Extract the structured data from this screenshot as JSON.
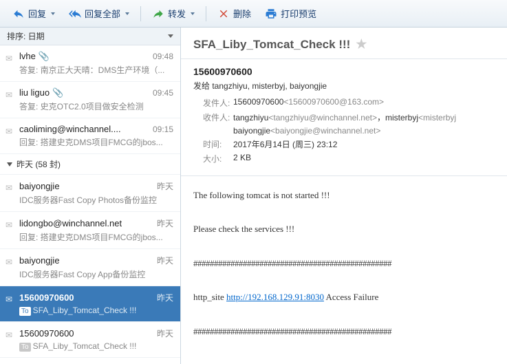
{
  "toolbar": {
    "reply": "回复",
    "reply_all": "回复全部",
    "forward": "转发",
    "delete": "删除",
    "print": "打印预览"
  },
  "sort": {
    "label": "排序: 日期"
  },
  "group": {
    "yesterday": "昨天 (58 封)"
  },
  "messages": [
    {
      "from": "lvhe",
      "time": "09:48",
      "subject": "答复: 南京正大天晴：DMS生产环境（...",
      "attach": true
    },
    {
      "from": "liu liguo",
      "time": "09:45",
      "subject": "答复: 史克OTC2.0项目做安全检测",
      "attach": true
    },
    {
      "from": "caoliming@winchannel....",
      "time": "09:15",
      "subject": "回复: 搭建史克DMS项目FMCG的jbos..."
    },
    {
      "from": "baiyongjie",
      "time": "昨天",
      "subject": "IDC服务器Fast Copy Photos备份监控"
    },
    {
      "from": "lidongbo@winchannel.net",
      "time": "昨天",
      "subject": "回复: 搭建史克DMS项目FMCG的jbos..."
    },
    {
      "from": "baiyongjie",
      "time": "昨天",
      "subject": "IDC服务器Fast Copy App备份监控"
    },
    {
      "from": "15600970600",
      "time": "昨天",
      "subject": "SFA_Liby_Tomcat_Check !!!",
      "to_badge": true,
      "selected": true
    },
    {
      "from": "15600970600",
      "time": "昨天",
      "subject": "SFA_Liby_Tomcat_Check !!!",
      "to_badge": true
    }
  ],
  "detail": {
    "title": "SFA_Liby_Tomcat_Check !!!",
    "sender": "15600970600",
    "recipients": "发给 tangzhiyu, misterbyj, baiyongjie",
    "from_label": "发件人:",
    "from_val": "15600970600",
    "from_addr": "<15600970600@163.com>",
    "to_label": "收件人:",
    "to_val1": "tangzhiyu",
    "to_addr1": "<tangzhiyu@winchannel.net>",
    "to_val2": "misterbyj",
    "to_addr2": "<misterbyj",
    "to_val3": "baiyongjie",
    "to_addr3": "<baiyongjie@winchannel.net>",
    "time_label": "时间:",
    "time_val": "2017年6月14日 (周三) 23:12",
    "size_label": "大小:",
    "size_val": "2 KB",
    "body_line1": "The following tomcat is not started !!!",
    "body_line2": "Please check the services !!!",
    "body_hashes": "################################################",
    "body_line3_pre": "http_site ",
    "body_line3_link": "http://192.168.129.91:8030",
    "body_line3_post": " Access Failure"
  },
  "badges": {
    "to": "To"
  }
}
